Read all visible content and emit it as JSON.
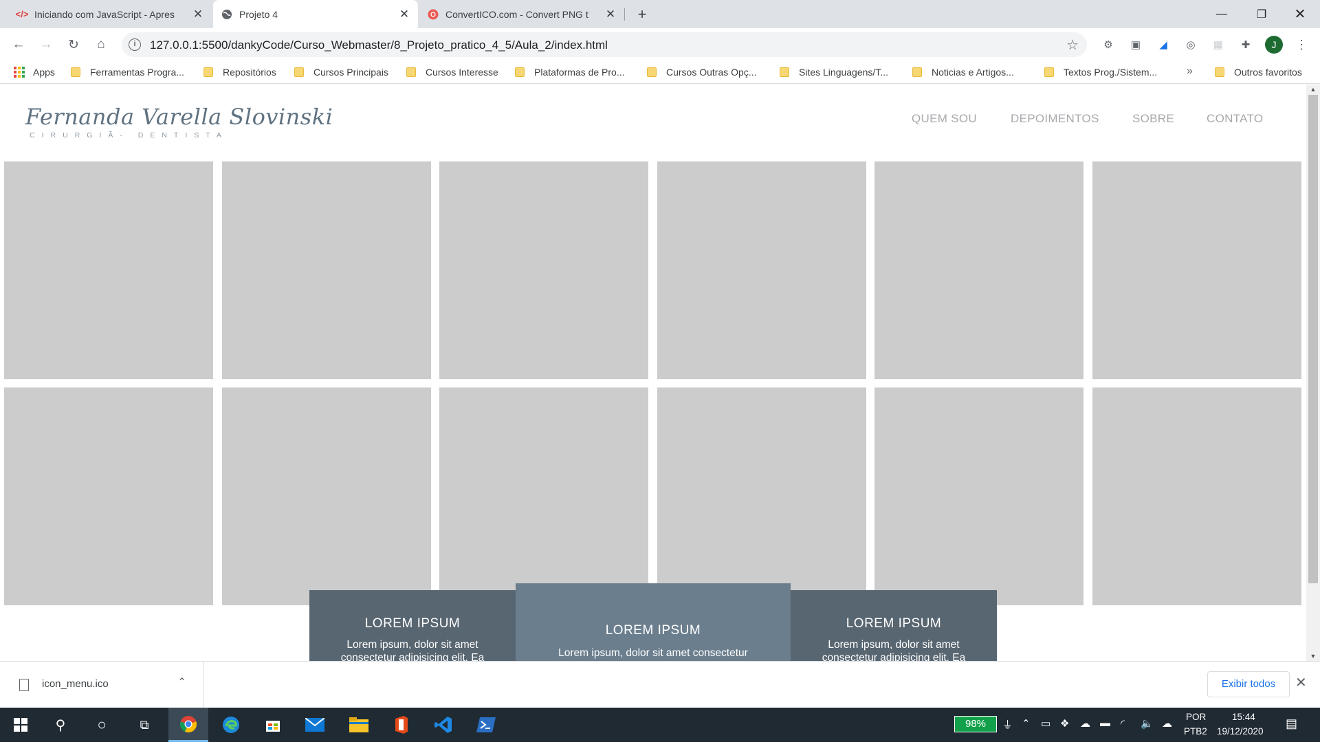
{
  "browser": {
    "tabs": [
      {
        "title": "Iniciando com JavaScript - Apres",
        "favicon": "code-icon"
      },
      {
        "title": "Projeto 4",
        "favicon": "globe-icon"
      },
      {
        "title": "ConvertICO.com - Convert PNG t",
        "favicon": "converticon-icon"
      }
    ],
    "address": "127.0.0.1:5500/dankyCode/Curso_Webmaster/8_Projeto_pratico_4_5/Aula_2/index.html",
    "avatar_letter": "J",
    "bookmarks": [
      "Apps",
      "Ferramentas Progra...",
      "Repositórios",
      "Cursos Principais",
      "Cursos Interesse",
      "Plataformas de Pro...",
      "Cursos Outras Opç...",
      "Sites Linguagens/T...",
      "Noticias e Artigos...",
      "Textos Prog./Sistem...",
      "Outros favoritos"
    ],
    "bookmarks_more": "»"
  },
  "site": {
    "logo_name": "Fernanda Varella Slovinski",
    "logo_sub": "CIRURGIÃ- DENTISTA",
    "nav": [
      "QUEM SOU",
      "DEPOIMENTOS",
      "SOBRE",
      "CONTATO"
    ],
    "cards": [
      {
        "title": "LOREM IPSUM",
        "text": "Lorem ipsum, dolor sit amet consectetur adipisicing elit. Ea"
      },
      {
        "title": "LOREM IPSUM",
        "text": "Lorem ipsum, dolor sit amet consectetur"
      },
      {
        "title": "LOREM IPSUM",
        "text": "Lorem ipsum, dolor sit amet consectetur adipisicing elit. Ea"
      }
    ]
  },
  "downloads": {
    "file": "icon_menu.ico",
    "show_all": "Exibir todos"
  },
  "taskbar": {
    "battery": "98%",
    "lang_1": "POR",
    "lang_2": "PTB2",
    "time": "15:44",
    "date": "19/12/2020"
  },
  "colors": {
    "tile": "#cccccc",
    "card_side": "#586671",
    "card_mid": "#6b7e8e",
    "nav_text": "#a7a9ac",
    "logo": "#5f7281"
  }
}
